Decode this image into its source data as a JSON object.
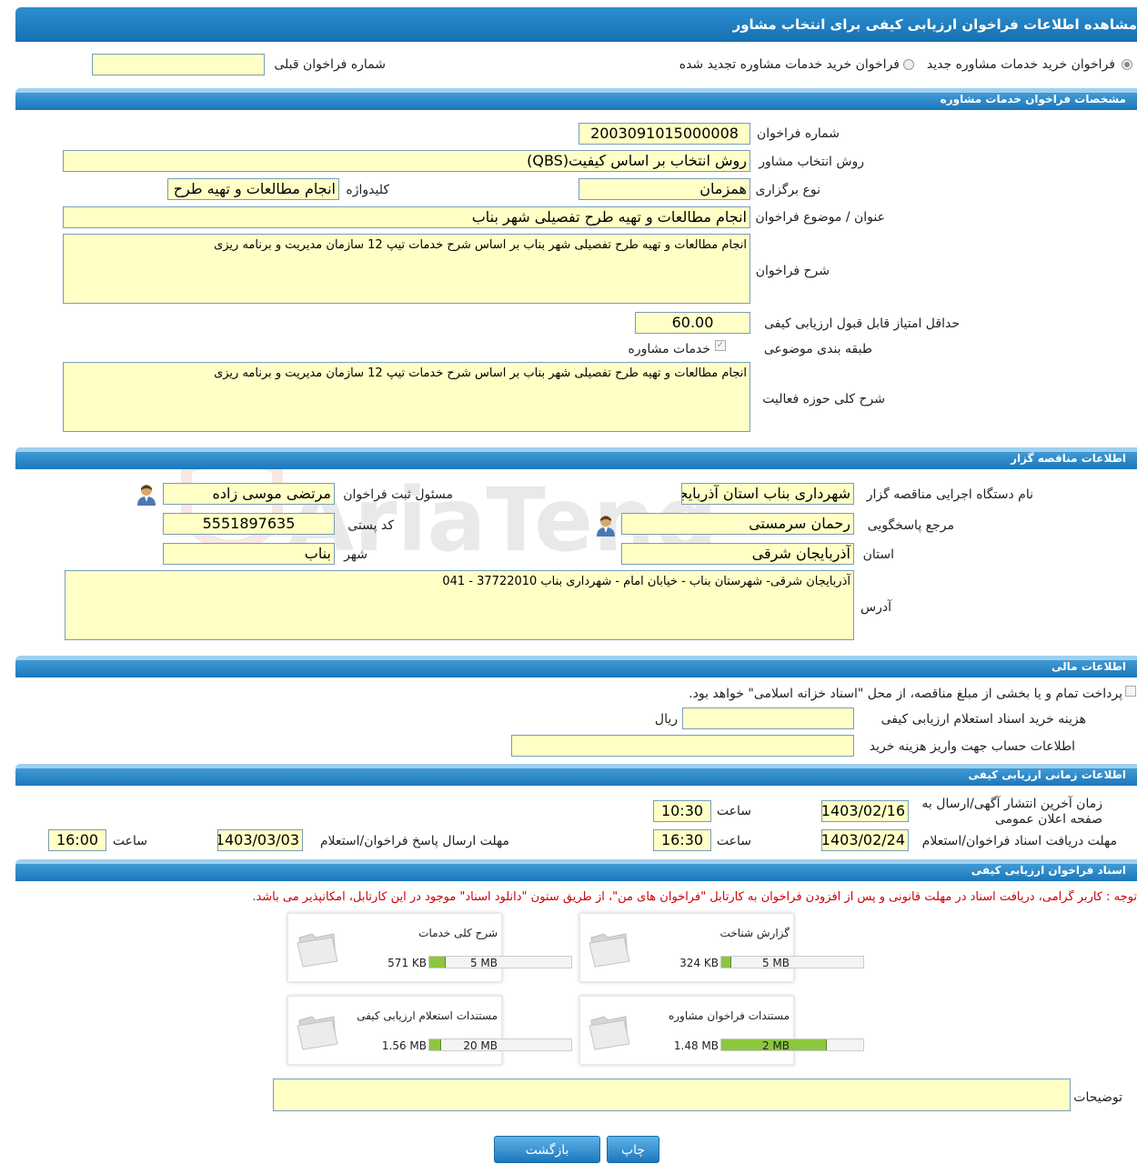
{
  "page_title": "مشاهده اطلاعات فراخوان ارزیابی کیفی برای انتخاب مشاور",
  "top": {
    "radio_new": "فراخوان خرید خدمات مشاوره جدید",
    "radio_renew": "فراخوان خرید خدمات مشاوره تجدید شده",
    "prev_label": "شماره فراخوان قبلی",
    "prev_value": ""
  },
  "sec1": {
    "title": "مشخصات فراخوان خدمات مشاوره",
    "number_label": "شماره فراخوان",
    "number_value": "2003091015000008",
    "method_label": "روش انتخاب مشاور",
    "method_value": "روش انتخاب بر اساس کیفیت(QBS)",
    "type_label": "نوع برگزاری",
    "type_value": "همزمان",
    "keyword_label": "کلیدواژه",
    "keyword_value": "انجام مطالعات و تهیه طرح ت",
    "subject_label": "عنوان / موضوع فراخوان",
    "subject_value": "انجام مطالعات و تهیه طرح تفصیلی شهر بناب",
    "desc_label": "شرح فراخوان",
    "desc_value": "انجام مطالعات و تهیه طرح تفصیلی شهر بناب بر اساس شرح خدمات تیپ 12 سازمان مدیریت و برنامه ریزی",
    "minscore_label": "حداقل امتیاز قابل قبول ارزیابی کیفی",
    "minscore_value": "60.00",
    "category_label": "طبقه بندی موضوعی",
    "category_value": "خدمات مشاوره",
    "scope_label": "شرح کلی حوزه فعالیت",
    "scope_value": "انجام مطالعات و تهیه طرح تفصیلی شهر بناب بر اساس شرح خدمات تیپ 12 سازمان مدیریت و برنامه ریزی"
  },
  "sec2": {
    "title": "اطلاعات مناقصه گزار",
    "org_label": "نام دستگاه اجرایی مناقصه گزار",
    "org_value": "شهرداری بناب استان آذربایجان",
    "registrar_label": "مسئول ثبت فراخوان",
    "registrar_value": "مرتضی موسی زاده",
    "contact_label": "مرجع پاسخگویی",
    "contact_value": "رحمان سرمستی",
    "postal_label": "کد پستی",
    "postal_value": "5551897635",
    "province_label": "استان",
    "province_value": "آذربایجان شرقی",
    "city_label": "شهر",
    "city_value": "بناب",
    "address_label": "آدرس",
    "address_value": "آذربایجان شرقی- شهرستان بناب - خیابان امام - شهرداری بناب  37722010 - 041"
  },
  "sec3": {
    "title": "اطلاعات مالی",
    "treasury_text": "پرداخت تمام و یا بخشی از مبلغ مناقصه، از محل \"اسناد خزانه اسلامی\" خواهد بود.",
    "cost_label": "هزینه خرید اسناد استعلام ارزیابی کیفی",
    "cost_value": "",
    "cost_unit": "ریال",
    "account_label": "اطلاعات حساب جهت واریز هزینه خرید",
    "account_value": ""
  },
  "sec4": {
    "title": "اطلاعات زمانی ارزیابی کیفی",
    "publish_label": "زمان آخرین انتشار آگهی/ارسال به صفحه اعلان عمومی",
    "publish_date": "1403/02/16",
    "time_label": "ساعت",
    "publish_time": "10:30",
    "receive_label": "مهلت دریافت اسناد فراخوان/استعلام",
    "receive_date": "1403/02/24",
    "receive_time": "16:30",
    "submit_label": "مهلت ارسال پاسخ فراخوان/استعلام",
    "submit_date": "1403/03/03",
    "submit_time": "16:00"
  },
  "sec5": {
    "title": "اسناد فراخوان ارزیابی کیفی",
    "notice": "توجه : کاربر گرامی، دریافت اسناد در مهلت قانونی و پس از افزودن فراخوان به کارتابل \"فراخوان های من\"، از طریق ستون \"دانلود اسناد\" موجود در این کارتابل، امکانپذیر می باشد.",
    "docs": [
      {
        "title": "گزارش شناخت",
        "size": "324 KB",
        "max": "5 MB",
        "fill": 0.065
      },
      {
        "title": "شرح کلی خدمات",
        "size": "571 KB",
        "max": "5 MB",
        "fill": 0.11
      },
      {
        "title": "مستندات فراخوان مشاوره",
        "size": "1.48 MB",
        "max": "2 MB",
        "fill": 0.74
      },
      {
        "title": "مستندات استعلام ارزیابی کیفی",
        "size": "1.56 MB",
        "max": "20 MB",
        "fill": 0.078
      }
    ],
    "notes_label": "توضیحات",
    "notes_value": ""
  },
  "buttons": {
    "print": "چاپ",
    "back": "بازگشت"
  },
  "colors": {
    "header": "#1670b3",
    "field_bg": "#ffffc6",
    "progress": "#8dc63f",
    "notice": "#d00000"
  }
}
